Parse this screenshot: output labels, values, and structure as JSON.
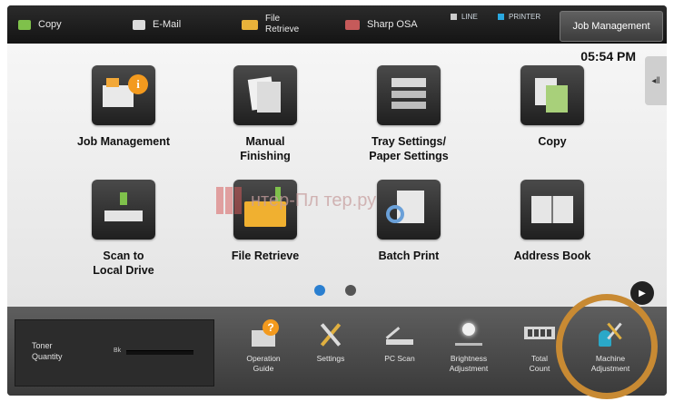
{
  "topbar": {
    "items": [
      {
        "label": "Copy",
        "icon": "copy-icon"
      },
      {
        "label": "E-Mail",
        "icon": "email-icon"
      },
      {
        "label_line1": "File",
        "label_line2": "Retrieve",
        "icon": "file-retrieve-icon"
      },
      {
        "label": "Sharp OSA",
        "icon": "sharp-osa-icon"
      }
    ],
    "status": [
      {
        "label": "LINE",
        "color": "#cccccc"
      },
      {
        "label": "PRINTER",
        "color": "#2aa8e0"
      }
    ],
    "job_management_label": "Job Management"
  },
  "home": {
    "clock": "05:54 PM",
    "side_tab_glyph": "◂‖",
    "tiles": [
      {
        "label": "Job Management",
        "icon": "job-management-icon"
      },
      {
        "label_line1": "Manual",
        "label_line2": "Finishing",
        "icon": "manual-finishing-icon"
      },
      {
        "label_line1": "Tray Settings/",
        "label_line2": "Paper Settings",
        "icon": "tray-settings-icon"
      },
      {
        "label": "Copy",
        "icon": "copy-icon"
      },
      {
        "label_line1": "Scan to",
        "label_line2": "Local Drive",
        "icon": "scan-to-local-drive-icon"
      },
      {
        "label": "File Retrieve",
        "icon": "file-retrieve-icon"
      },
      {
        "label": "Batch Print",
        "icon": "batch-print-icon"
      },
      {
        "label": "Address Book",
        "icon": "address-book-icon"
      }
    ],
    "watermark": "нтер-Пл   тер.ру",
    "page_dots": [
      {
        "state": "active",
        "color": "#2a7fd0"
      },
      {
        "state": "inactive",
        "color": "#555555"
      }
    ],
    "next_glyph": "▶"
  },
  "bottombar": {
    "toner": {
      "label_line1": "Toner",
      "label_line2": "Quantity",
      "channel": "Bk"
    },
    "items": [
      {
        "label_line1": "Operation",
        "label_line2": "Guide",
        "icon": "operation-guide-icon"
      },
      {
        "label": "Settings",
        "icon": "settings-icon"
      },
      {
        "label": "PC Scan",
        "icon": "pc-scan-icon"
      },
      {
        "label_line1": "Brightness",
        "label_line2": "Adjustment",
        "icon": "brightness-icon"
      },
      {
        "label_line1": "Total",
        "label_line2": "Count",
        "icon": "total-count-icon"
      },
      {
        "label_line1": "Machine",
        "label_line2": "Adjustment",
        "icon": "machine-adjustment-icon"
      }
    ]
  },
  "colors": {
    "accent_ring": "#c88a33",
    "info_orange": "#f39a1e"
  }
}
